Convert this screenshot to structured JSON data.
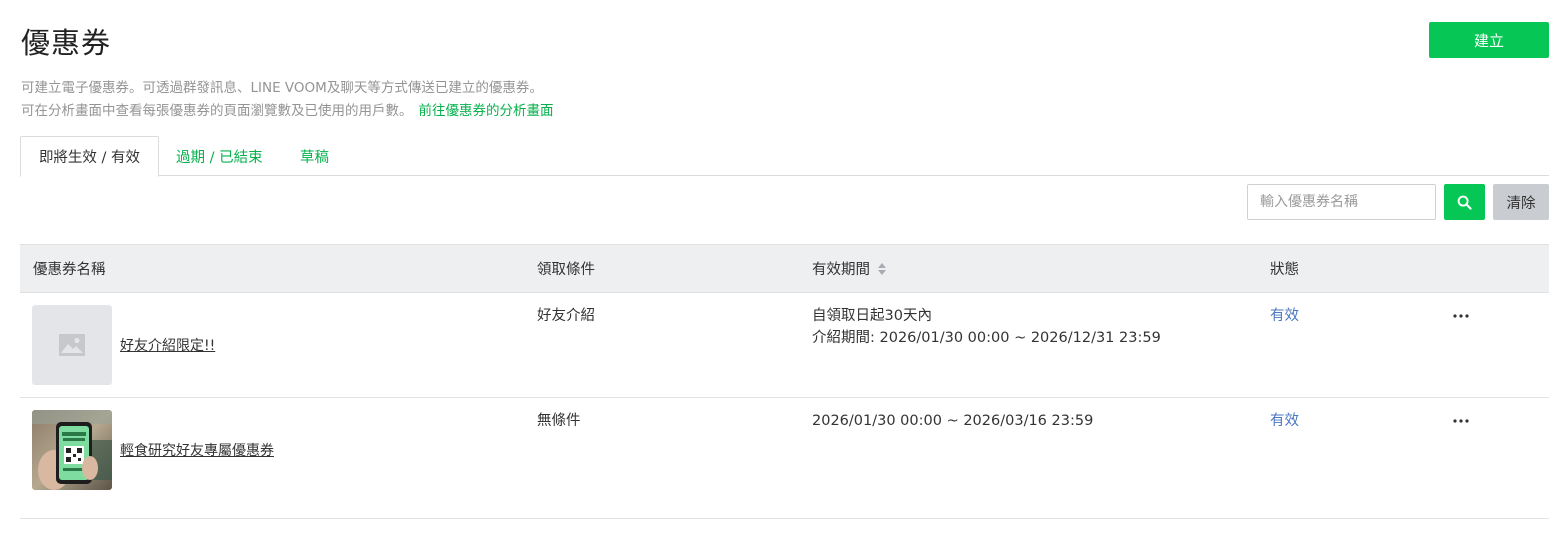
{
  "header": {
    "title": "優惠券",
    "create_label": "建立"
  },
  "description": {
    "line1": "可建立電子優惠券。可透過群發訊息、LINE VOOM及聊天等方式傳送已建立的優惠券。",
    "line2": "可在分析畫面中查看每張優惠券的頁面瀏覽數及已使用的用戶數。",
    "link": "前往優惠券的分析畫面"
  },
  "tabs": [
    {
      "label": "即將生效 / 有效",
      "active": true
    },
    {
      "label": "過期 / 已結束",
      "active": false
    },
    {
      "label": "草稿",
      "active": false
    }
  ],
  "search": {
    "placeholder": "輸入優惠券名稱",
    "value": "",
    "clear_label": "清除"
  },
  "table": {
    "columns": [
      "優惠券名稱",
      "領取條件",
      "有效期間",
      "狀態"
    ],
    "rows": [
      {
        "name": "好友介紹限定!!",
        "condition": "好友介紹",
        "period_line1": "自領取日起30天內",
        "period_line2": "介紹期間: 2026/01/30 00:00 ~ 2026/12/31 23:59",
        "status": "有效",
        "thumbnail": "placeholder-image-icon"
      },
      {
        "name": "輕食研究好友專屬優惠券",
        "condition": "無條件",
        "period_line1": "2026/01/30 00:00 ~ 2026/03/16 23:59",
        "period_line2": "",
        "status": "有效",
        "thumbnail": "coupon-photo"
      }
    ]
  },
  "colors": {
    "brand_green": "#06c755",
    "link_green": "#06b14c",
    "status_blue": "#4a76c4",
    "header_bg": "#eeeff1"
  }
}
